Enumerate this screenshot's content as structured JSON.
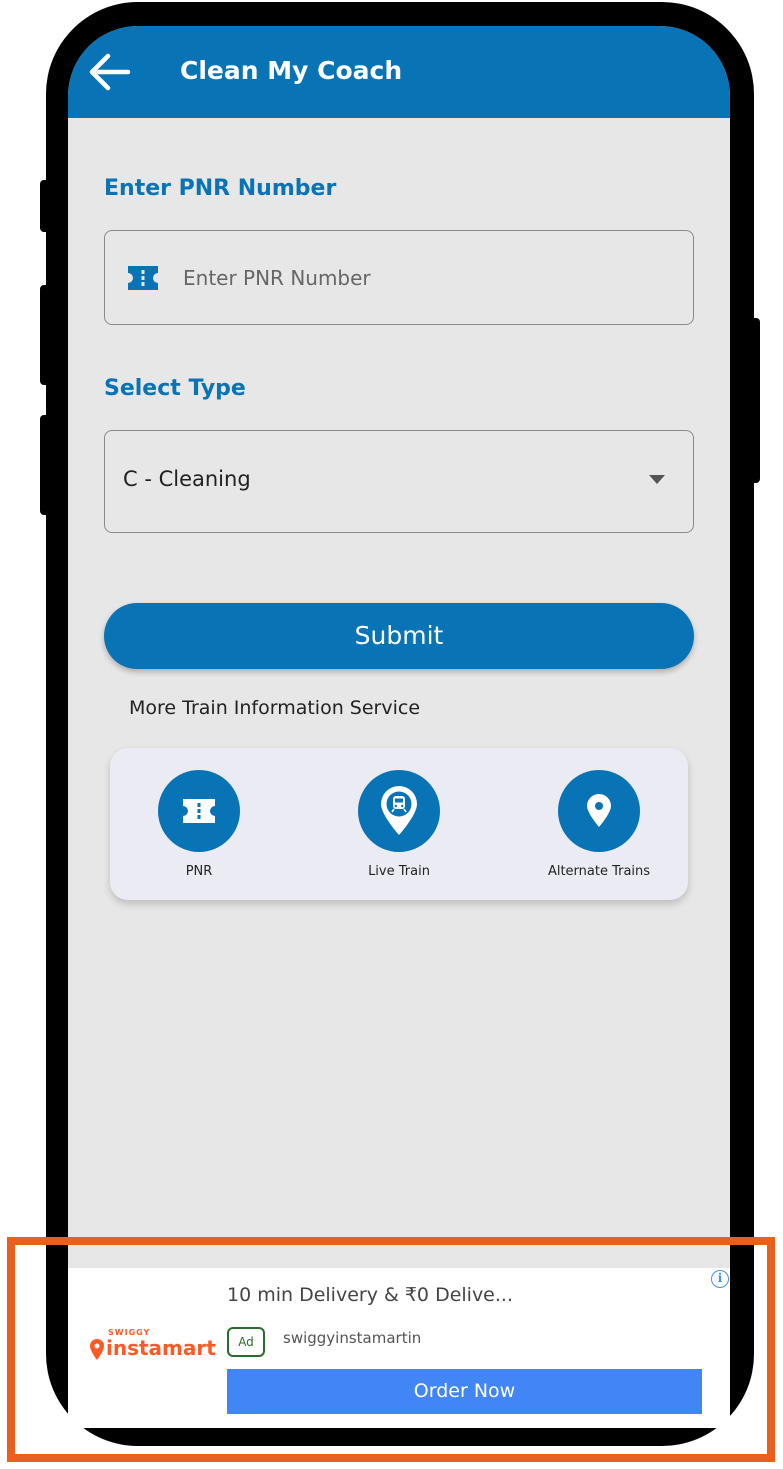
{
  "app_bar": {
    "title": "Clean My Coach",
    "back_icon": "arrow-left-icon",
    "color": "#0873b5"
  },
  "pnr": {
    "label": "Enter PNR Number",
    "placeholder": "Enter PNR Number",
    "value": "",
    "icon": "ticket-icon"
  },
  "type_select": {
    "label": "Select Type",
    "selected": "C - Cleaning",
    "icon": "caret-down-icon"
  },
  "submit_label": "Submit",
  "more_services": {
    "label": "More Train Information Service",
    "items": [
      {
        "label": "PNR",
        "icon": "ticket-icon"
      },
      {
        "label": "Live Train",
        "icon": "train-location-icon"
      },
      {
        "label": "Alternate Trains",
        "icon": "location-pin-icon"
      }
    ]
  },
  "ad": {
    "brand_small": "SWIGGY",
    "brand_name": "instamart",
    "headline": "10 min Delivery & ₹0 Delive...",
    "badge": "Ad",
    "source": "swiggyinstamartin",
    "cta": "Order Now",
    "info_icon": "info-icon",
    "brand_color": "#fc5a27",
    "cta_color": "#4285f4"
  },
  "highlight_color": "#e8601c"
}
